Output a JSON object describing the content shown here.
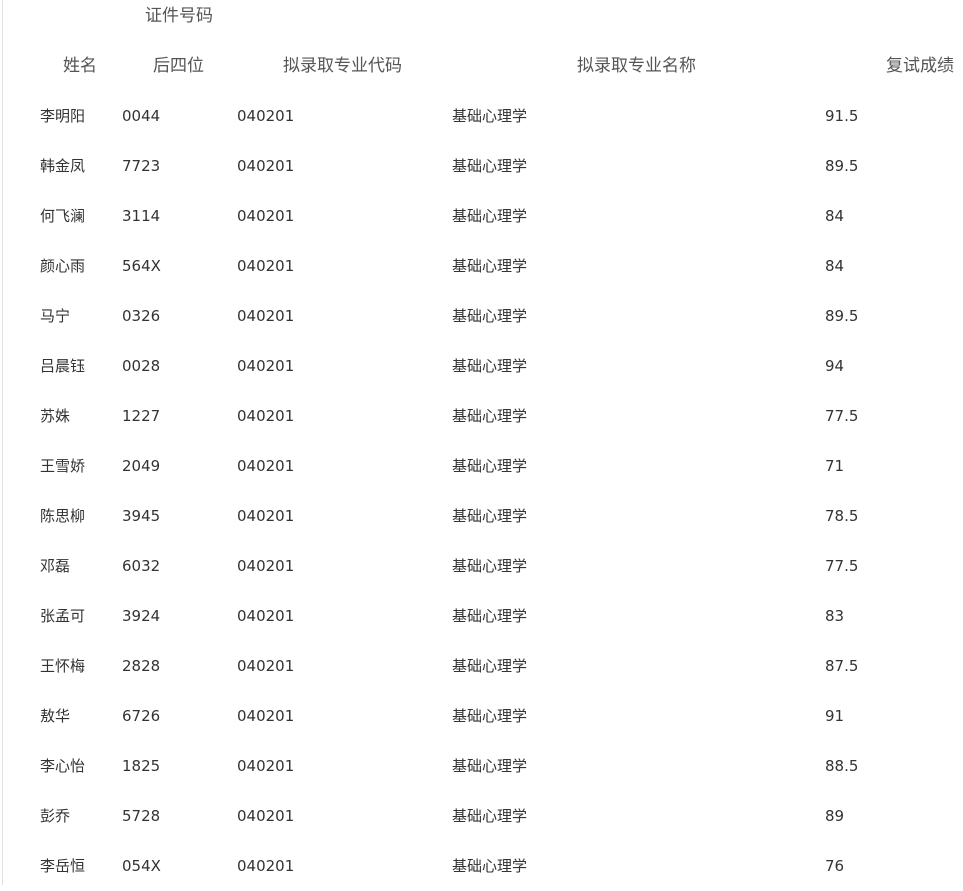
{
  "table": {
    "headers": {
      "id_top": "证件号码",
      "name": "姓名",
      "id_last4": "后四位",
      "major_code": "拟录取专业代码",
      "major_name": "拟录取专业名称",
      "score": "复试成绩"
    },
    "rows": [
      {
        "name": "李明阳",
        "id_last4": "0044",
        "major_code": "040201",
        "major_name": "基础心理学",
        "score": "91.5"
      },
      {
        "name": "韩金凤",
        "id_last4": "7723",
        "major_code": "040201",
        "major_name": "基础心理学",
        "score": "89.5"
      },
      {
        "name": "何飞澜",
        "id_last4": "3114",
        "major_code": "040201",
        "major_name": "基础心理学",
        "score": "84"
      },
      {
        "name": "颜心雨",
        "id_last4": "564X",
        "major_code": "040201",
        "major_name": "基础心理学",
        "score": "84"
      },
      {
        "name": "马宁",
        "id_last4": "0326",
        "major_code": "040201",
        "major_name": "基础心理学",
        "score": "89.5"
      },
      {
        "name": "吕晨钰",
        "id_last4": "0028",
        "major_code": "040201",
        "major_name": "基础心理学",
        "score": "94"
      },
      {
        "name": "苏姝",
        "id_last4": "1227",
        "major_code": "040201",
        "major_name": "基础心理学",
        "score": "77.5"
      },
      {
        "name": "王雪娇",
        "id_last4": "2049",
        "major_code": "040201",
        "major_name": "基础心理学",
        "score": "71"
      },
      {
        "name": "陈思柳",
        "id_last4": "3945",
        "major_code": "040201",
        "major_name": "基础心理学",
        "score": "78.5"
      },
      {
        "name": "邓磊",
        "id_last4": "6032",
        "major_code": "040201",
        "major_name": "基础心理学",
        "score": "77.5"
      },
      {
        "name": "张孟可",
        "id_last4": "3924",
        "major_code": "040201",
        "major_name": "基础心理学",
        "score": "83"
      },
      {
        "name": "王怀梅",
        "id_last4": "2828",
        "major_code": "040201",
        "major_name": "基础心理学",
        "score": "87.5"
      },
      {
        "name": "敖华",
        "id_last4": "6726",
        "major_code": "040201",
        "major_name": "基础心理学",
        "score": "91"
      },
      {
        "name": "李心怡",
        "id_last4": "1825",
        "major_code": "040201",
        "major_name": "基础心理学",
        "score": "88.5"
      },
      {
        "name": "彭乔",
        "id_last4": "5728",
        "major_code": "040201",
        "major_name": "基础心理学",
        "score": "89"
      },
      {
        "name": "李岳恒",
        "id_last4": "054X",
        "major_code": "040201",
        "major_name": "基础心理学",
        "score": "76"
      }
    ]
  }
}
